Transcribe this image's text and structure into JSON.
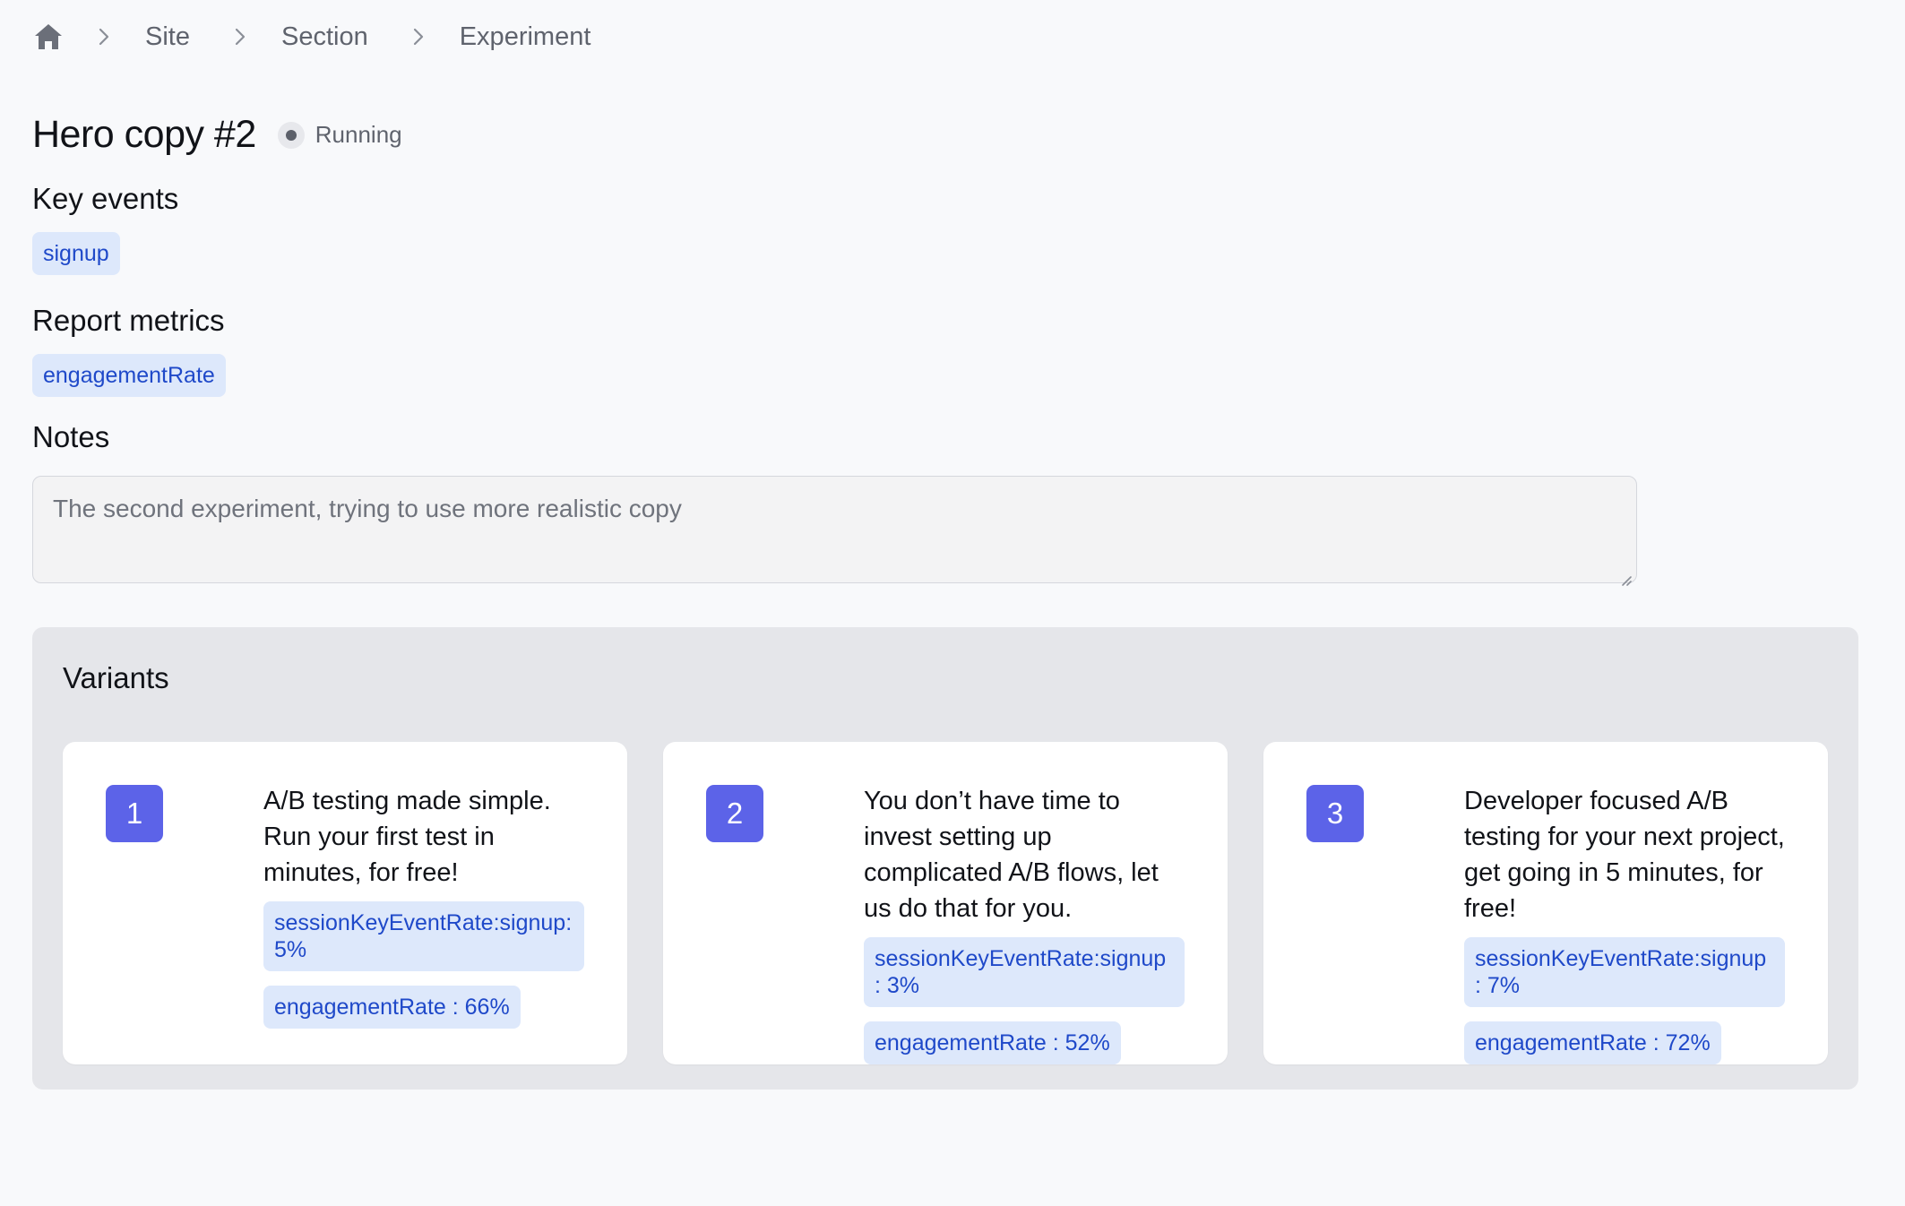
{
  "breadcrumb": {
    "home_icon": "home-icon",
    "separator_icon": "chevron-right-icon",
    "items": [
      "Site",
      "Section",
      "Experiment"
    ]
  },
  "experiment": {
    "title": "Hero copy #2",
    "status": "Running"
  },
  "key_events": {
    "label": "Key events",
    "items": [
      "signup"
    ]
  },
  "report_metrics": {
    "label": "Report metrics",
    "items": [
      "engagementRate"
    ]
  },
  "notes": {
    "label": "Notes",
    "value": "The second experiment, trying to use more realistic copy"
  },
  "variants": {
    "label": "Variants",
    "items": [
      {
        "number": "1",
        "text": "A/B testing made simple. Run your first test in minutes, for free!",
        "metrics": [
          "sessionKeyEventRate:signup: 5%",
          "engagementRate : 66%"
        ]
      },
      {
        "number": "2",
        "text": "You don’t have time to invest setting up complicated A/B flows, let us do that for you.",
        "metrics": [
          "sessionKeyEventRate:signup : 3%",
          "engagementRate : 52%"
        ]
      },
      {
        "number": "3",
        "text": "Developer focused A/B testing for your next project, get going in 5 minutes, for free!",
        "metrics": [
          "sessionKeyEventRate:signup : 7%",
          "engagementRate : 72%"
        ]
      }
    ]
  },
  "colors": {
    "accent": "#5c63e8",
    "chip_bg": "#dde8fb",
    "chip_text": "#1f49c9",
    "panel_bg": "#e5e6ea",
    "page_bg": "#f8f9fb"
  }
}
